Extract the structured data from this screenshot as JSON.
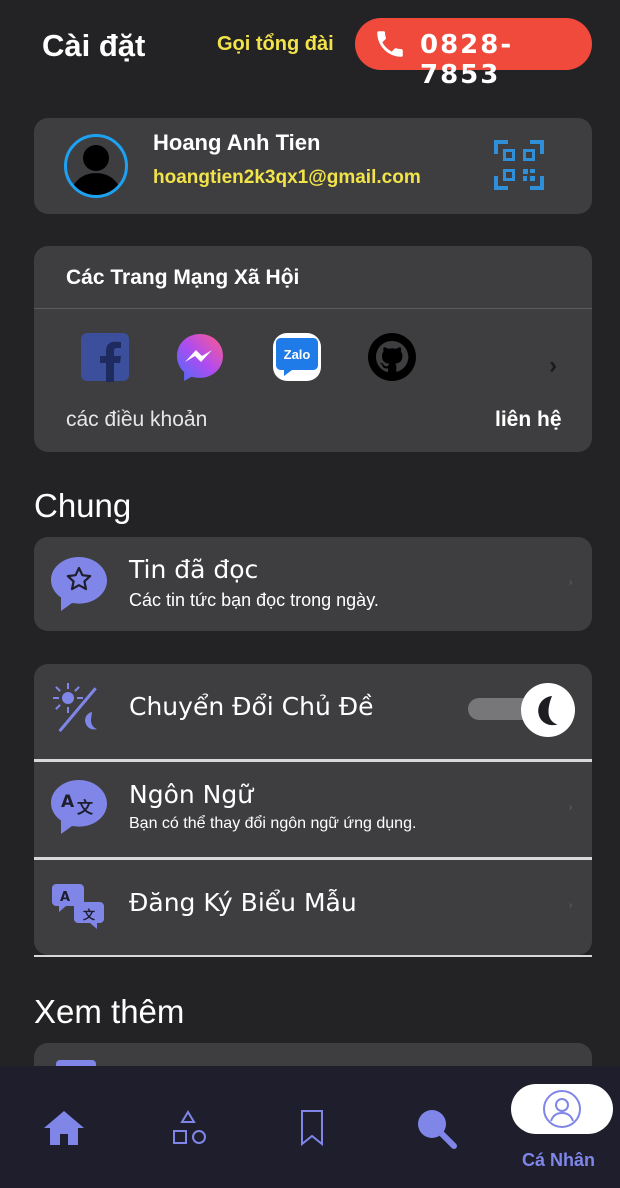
{
  "header": {
    "title": "Cài đặt",
    "hotline_label": "Gọi tổng đài",
    "hotline_number": "0828-7853"
  },
  "profile": {
    "name": "Hoang Anh Tien",
    "email": "hoangtien2k3qx1@gmail.com"
  },
  "social": {
    "title": "Các Trang Mạng Xã Hội",
    "icons": [
      "facebook-icon",
      "messenger-icon",
      "zalo-icon",
      "github-icon"
    ],
    "zalo_text": "Zalo",
    "terms": "các điều khoản",
    "contact": "liên hệ"
  },
  "general": {
    "title": "Chung",
    "read_news": {
      "title": "Tin đã đọc",
      "subtitle": "Các tin tức bạn đọc trong ngày."
    },
    "theme": {
      "title": "Chuyển Đổi Chủ Đề",
      "dark_mode": true
    },
    "language": {
      "title": "Ngôn Ngữ",
      "subtitle": "Bạn có thể thay đổi ngôn ngữ ứng dụng."
    },
    "form": {
      "title": "Đăng Ký Biểu Mẫu"
    }
  },
  "more": {
    "title": "Xem thêm"
  },
  "bottom_nav": {
    "items": [
      "home-icon",
      "shapes-icon",
      "bookmark-icon",
      "search-icon",
      "profile-icon"
    ],
    "active_label": "Cá Nhân"
  },
  "colors": {
    "background": "#232325",
    "card": "#3e3e40",
    "accent_yellow": "#f2e34a",
    "call_red": "#f04a3c",
    "accent_purple": "#7f86e8"
  }
}
